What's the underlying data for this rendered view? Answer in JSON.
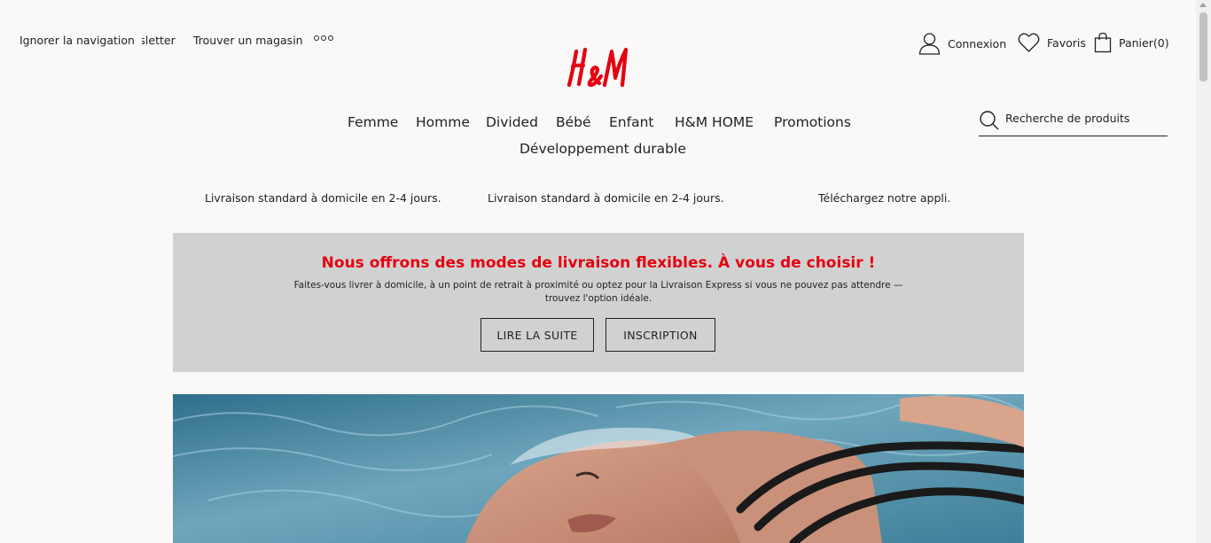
{
  "header": {
    "skip_nav": "Ignorer la navigation",
    "newsletter_partial": "vsletter",
    "store_locator": "Trouver un magasin",
    "more_icon": "more-dots-icon",
    "logo_text": "H&M",
    "brand_color": "#e50010",
    "user_nav": {
      "login": "Connexion",
      "favorites": "Favoris",
      "cart": "Panier(0)"
    }
  },
  "main_nav": {
    "items": [
      "Femme",
      "Homme",
      "Divided",
      "Bébé",
      "Enfant",
      "H&M HOME",
      "Promotions"
    ],
    "second_row": "Développement durable"
  },
  "search": {
    "placeholder": "Recherche de produits",
    "value": ""
  },
  "usp_bar": [
    "Livraison standard à domicile en 2-4 jours.",
    "Livraison standard à domicile en 2-4 jours.",
    "Téléchargez notre appli."
  ],
  "promo": {
    "headline": "Nous offrons des modes de livraison flexibles. À vous de choisir !",
    "body": "Faites-vous livrer à domicile, à un point de retrait à proximité ou optez pour la Livraison Express si vous ne pouvez pas attendre — trouvez l'option idéale.",
    "read_more": "LIRE LA SUITE",
    "signup": "INSCRIPTION",
    "background": "#d0d2d2"
  },
  "hero": {
    "image": "woman-floating-in-water-photo"
  }
}
